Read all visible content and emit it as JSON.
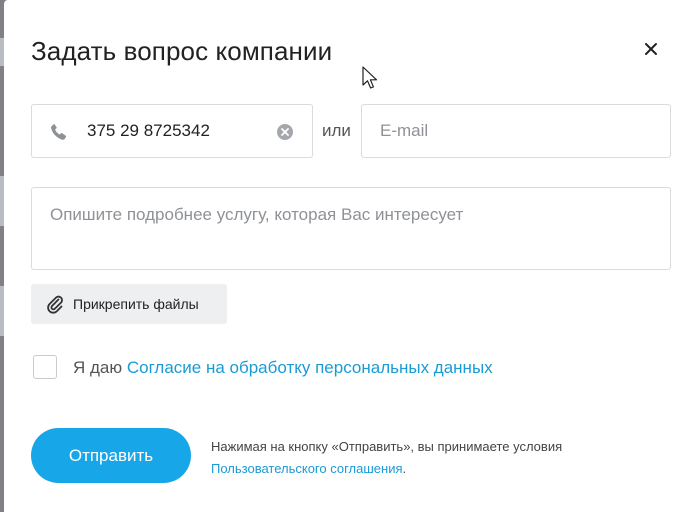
{
  "dialog": {
    "title": "Задать вопрос компании"
  },
  "contact": {
    "phone_value": "375 29 8725342",
    "or_label": "или",
    "email_placeholder": "E-mail"
  },
  "description": {
    "placeholder": "Опишите подробнее услугу, которая Вас интересует"
  },
  "attach": {
    "label": "Прикрепить файлы"
  },
  "consent": {
    "prefix": "Я даю ",
    "link_text": "Согласие на обработку персональных данных"
  },
  "submit": {
    "label": "Отправить",
    "terms_text": "Нажимая на кнопку «Отправить», вы принимаете условия",
    "terms_link": "Пользовательского соглашения",
    "terms_suffix": "."
  },
  "colors": {
    "accent": "#17a7e8",
    "link": "#1a9bd6"
  },
  "icons": {
    "close": "close-icon",
    "phone": "phone-icon",
    "clear": "clear-icon",
    "attach": "paperclip-icon"
  }
}
